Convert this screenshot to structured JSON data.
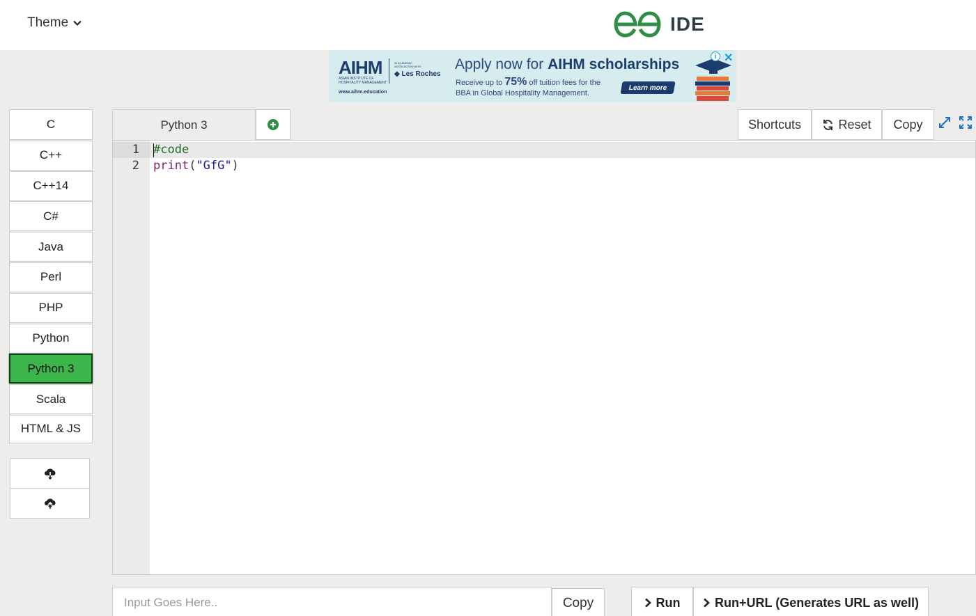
{
  "header": {
    "theme_label": "Theme",
    "brand_title": "IDE",
    "brand_color": "#2f8d46"
  },
  "ad": {
    "brand": "AIHM",
    "brand_sub": "ASIAN INSTITUTE OF HOSPITALITY MANAGEMENT",
    "partner_small": "IN ACADEMIC ASSOCIATION WITH",
    "partner": "◆ Les Roches",
    "url": "www.aihm.education",
    "headline_pre": "Apply now for ",
    "headline_bold": "AIHM scholarships",
    "line1_pre": "Receive up to ",
    "line1_bold": "75%",
    "line1_post": " off tuition fees for the",
    "line2": "BBA in Global Hospitality Management.",
    "cta": "Learn more",
    "info": "i",
    "close": "✕"
  },
  "languages": [
    {
      "label": "C",
      "active": false
    },
    {
      "label": "C++",
      "active": false
    },
    {
      "label": "C++14",
      "active": false
    },
    {
      "label": "C#",
      "active": false
    },
    {
      "label": "Java",
      "active": false
    },
    {
      "label": "Perl",
      "active": false
    },
    {
      "label": "PHP",
      "active": false
    },
    {
      "label": "Python",
      "active": false
    },
    {
      "label": "Python 3",
      "active": true
    },
    {
      "label": "Scala",
      "active": false
    },
    {
      "label": "HTML & JS",
      "active": false
    }
  ],
  "active_color": "#3cb64a",
  "cloud_buttons": [
    {
      "icon": "cloud-download-icon"
    },
    {
      "icon": "cloud-upload-icon"
    }
  ],
  "editor": {
    "tab_label": "Python 3",
    "add_tab_icon": "plus-circle-icon",
    "shortcuts_label": "Shortcuts",
    "reset_label": "Reset",
    "copy_label": "Copy",
    "lines": [
      {
        "num": "1",
        "text": "#code"
      },
      {
        "num": "2",
        "fn": "print",
        "open": "(",
        "str": "\"GfG\"",
        "close": ")"
      }
    ]
  },
  "bottom": {
    "input_placeholder": "Input Goes Here..",
    "input_value": "",
    "copy_label": "Copy",
    "run_label": "Run",
    "run_url_label": "Run+URL (Generates URL as well)"
  }
}
